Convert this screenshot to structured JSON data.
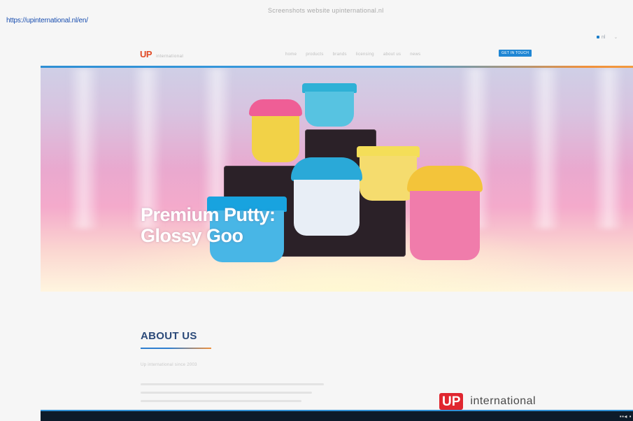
{
  "browser": {
    "url": "https://upinternational.nl/en/",
    "document_title": "Screenshots website upinternational.nl",
    "language": "nl"
  },
  "header": {
    "logo_main": "UP",
    "logo_sub": "international",
    "nav": [
      {
        "label": "home"
      },
      {
        "label": "products"
      },
      {
        "label": "brands"
      },
      {
        "label": "licensing"
      },
      {
        "label": "about us"
      },
      {
        "label": "news"
      }
    ],
    "contact_label": "GET IN TOUCH"
  },
  "hero": {
    "title_line1": "Premium Putty:",
    "title_line2": "Glossy Goo"
  },
  "about": {
    "title": "ABOUT US",
    "subtitle": "Up international since 2003",
    "brand_main": "UP",
    "brand_word": "international"
  },
  "colors": {
    "accent_blue": "#1f86d4",
    "accent_orange": "#f0913c",
    "logo_red": "#e14b26",
    "about_title": "#2c4a79"
  }
}
